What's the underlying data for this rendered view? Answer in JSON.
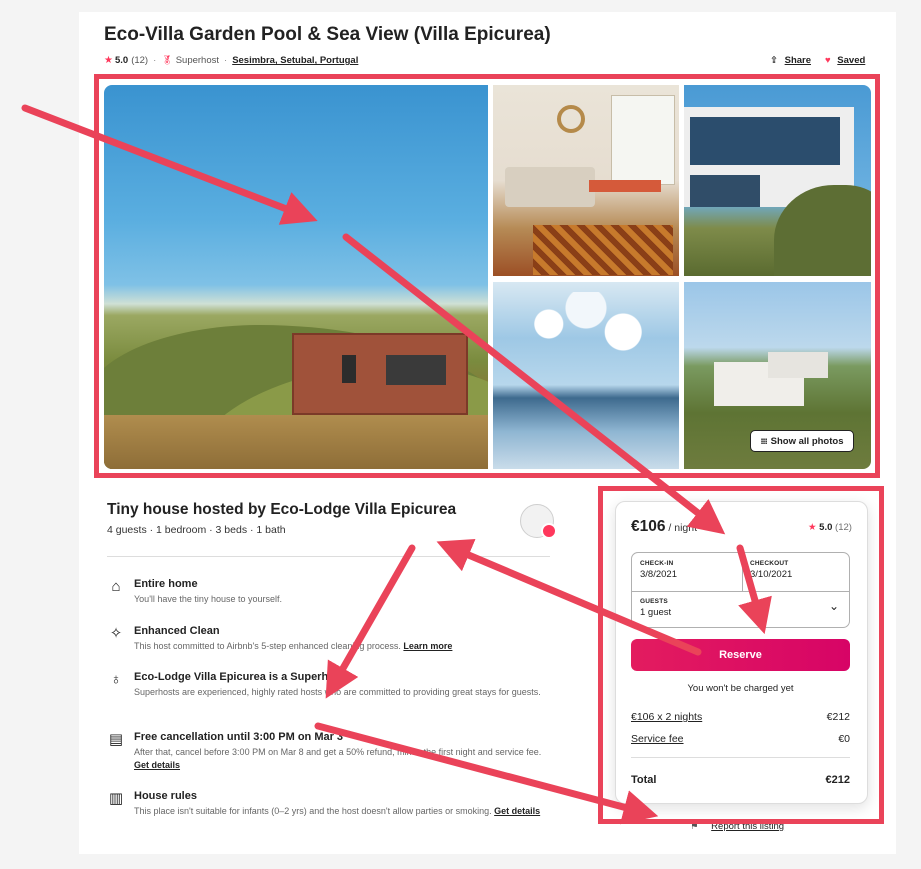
{
  "listing": {
    "title": "Eco-Villa Garden Pool & Sea View (Villa Epicurea)",
    "rating": "5.0",
    "reviews": "(12)",
    "superhost_label": "Superhost",
    "location": "Sesimbra, Setubal, Portugal",
    "share_label": "Share",
    "saved_label": "Saved",
    "show_all_photos": "Show all photos"
  },
  "details": {
    "heading": "Tiny house hosted by Eco-Lodge Villa Epicurea",
    "info": "4 guests · 1 bedroom · 3 beds · 1 bath",
    "features": [
      {
        "icon": "home-icon",
        "title": "Entire home",
        "desc": "You'll have the tiny house to yourself.",
        "link": ""
      },
      {
        "icon": "sparkle-icon",
        "title": "Enhanced Clean",
        "desc": "This host committed to Airbnb's 5-step enhanced cleaning process.",
        "link": "Learn more"
      },
      {
        "icon": "medal-icon",
        "title": "Eco-Lodge Villa Epicurea is a Superhost",
        "desc": "Superhosts are experienced, highly rated hosts who are committed to providing great stays for guests.",
        "link": ""
      },
      {
        "icon": "calendar-icon",
        "title": "Free cancellation until 3:00 PM on Mar 3",
        "desc": "After that, cancel before 3:00 PM on Mar 8 and get a 50% refund, minus the first night and service fee.",
        "link": "Get details"
      },
      {
        "icon": "book-icon",
        "title": "House rules",
        "desc": "This place isn't suitable for infants (0–2 yrs) and the host doesn't allow parties or smoking.",
        "link": "Get details"
      }
    ]
  },
  "booking": {
    "price": "€106",
    "per_night": " / night",
    "rating": "5.0",
    "reviews": "(12)",
    "checkin_label": "CHECK-IN",
    "checkin_value": "3/8/2021",
    "checkout_label": "CHECKOUT",
    "checkout_value": "3/10/2021",
    "guests_label": "GUESTS",
    "guests_value": "1 guest",
    "reserve_label": "Reserve",
    "no_charge": "You won't be charged yet",
    "nights_label": "€106 x 2 nights",
    "nights_value": "€212",
    "service_label": "Service fee",
    "service_value": "€0",
    "total_label": "Total",
    "total_value": "€212"
  },
  "footer": {
    "report_label": "Report this listing"
  },
  "colors": {
    "accent": "#FF385C",
    "annotation": "#ea4359"
  }
}
